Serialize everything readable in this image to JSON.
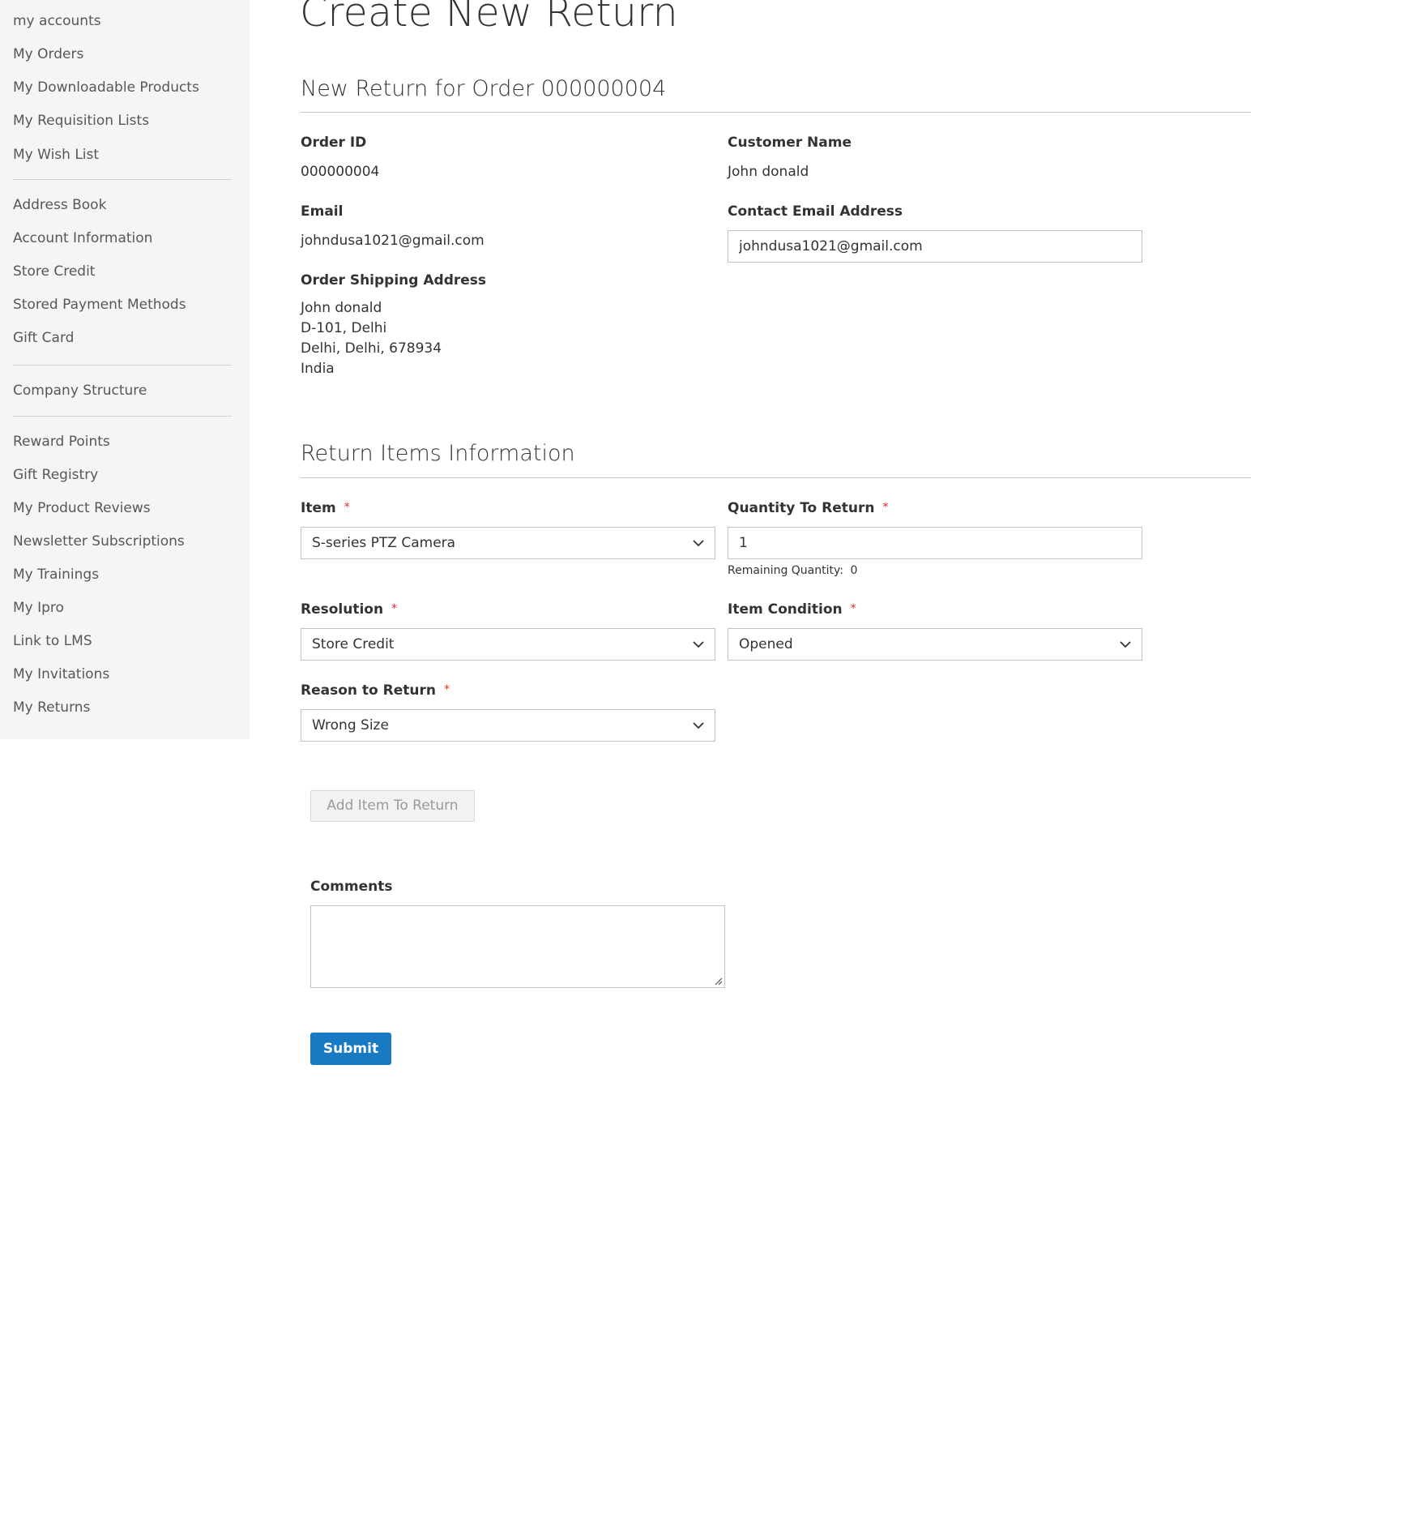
{
  "sidebar": {
    "group1": [
      {
        "label": "my accounts"
      },
      {
        "label": "My Orders"
      },
      {
        "label": "My Downloadable Products"
      },
      {
        "label": "My Requisition Lists"
      },
      {
        "label": "My Wish List"
      }
    ],
    "group2": [
      {
        "label": "Address Book"
      },
      {
        "label": "Account Information"
      },
      {
        "label": "Store Credit"
      },
      {
        "label": "Stored Payment Methods"
      },
      {
        "label": "Gift Card"
      }
    ],
    "group3": [
      {
        "label": "Company Structure"
      }
    ],
    "group4": [
      {
        "label": "Reward Points"
      },
      {
        "label": "Gift Registry"
      },
      {
        "label": "My Product Reviews"
      },
      {
        "label": "Newsletter Subscriptions"
      },
      {
        "label": "My Trainings"
      },
      {
        "label": "My Ipro"
      },
      {
        "label": "Link to LMS"
      },
      {
        "label": "My Invitations"
      },
      {
        "label": "My Returns"
      }
    ]
  },
  "main": {
    "page_title": "Create New Return",
    "order_section": {
      "title": "New Return for Order 000000004",
      "order_id_label": "Order ID",
      "order_id_value": "000000004",
      "customer_name_label": "Customer Name",
      "customer_name_value": "John donald",
      "email_label": "Email",
      "email_value": "johndusa1021@gmail.com",
      "contact_email_label": "Contact Email Address",
      "contact_email_value": "johndusa1021@gmail.com",
      "shipping_label": "Order Shipping Address",
      "shipping_lines": [
        "John donald",
        "D-101, Delhi",
        "Delhi, Delhi, 678934",
        "India"
      ]
    },
    "items_section": {
      "title": "Return Items Information",
      "item_label": "Item",
      "item_value": "S-series PTZ Camera",
      "qty_label": "Quantity To Return",
      "qty_value": "1",
      "remaining_label": "Remaining Quantity:",
      "remaining_value": "0",
      "resolution_label": "Resolution",
      "resolution_value": "Store Credit",
      "condition_label": "Item Condition",
      "condition_value": "Opened",
      "reason_label": "Reason to Return",
      "reason_value": "Wrong Size",
      "required_marker": "*"
    },
    "add_item_button": "Add Item To Return",
    "comments_label": "Comments",
    "submit_button": "Submit"
  },
  "colors": {
    "sidebar_bg": "#f5f5f5",
    "primary": "#1979c3",
    "required": "#e02b27",
    "border": "#c2c2c2"
  },
  "icons": {
    "select_arrow": "chevron-down-icon",
    "textarea_grip": "resize-grip-icon"
  }
}
